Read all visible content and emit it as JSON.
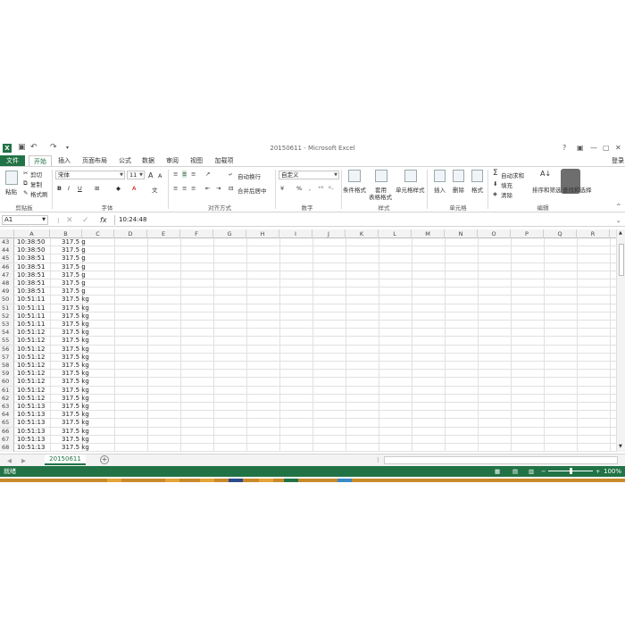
{
  "app": {
    "window_title": "20150611 - Microsoft Excel",
    "logo_letter": "X",
    "help": "?",
    "sign_in": "登录"
  },
  "tabs": [
    "文件",
    "开始",
    "插入",
    "页面布局",
    "公式",
    "数据",
    "审阅",
    "视图",
    "加载项"
  ],
  "ribbon": {
    "clipboard": {
      "paste": "粘贴",
      "cut": "剪切",
      "copy": "复制",
      "format_painter": "格式刷",
      "group": "剪贴板"
    },
    "font": {
      "name": "宋体",
      "size": "11",
      "bold": "B",
      "italic": "I",
      "underline": "U",
      "grow": "A",
      "shrink": "A",
      "group": "字体"
    },
    "alignment": {
      "wrap": "自动换行",
      "merge": "合并后居中",
      "group": "对齐方式"
    },
    "number": {
      "format": "自定义",
      "percent": "%",
      "comma": ",",
      "group": "数字"
    },
    "styles": {
      "conditional": "条件格式",
      "table1": "套用",
      "table2": "表格格式",
      "cell_styles": "单元格样式",
      "group": "样式"
    },
    "cells": {
      "insert": "插入",
      "delete": "删除",
      "format": "格式",
      "group": "单元格"
    },
    "editing": {
      "autosum": "自动求和",
      "fill": "填充",
      "clear": "清除",
      "sort": "排序和筛选",
      "find": "查找和选择",
      "group": "编辑"
    }
  },
  "formula_bar": {
    "name_box": "A1",
    "fx": "fx",
    "value": "10:24:48"
  },
  "columns": [
    "A",
    "B",
    "C",
    "D",
    "E",
    "F",
    "G",
    "H",
    "I",
    "J",
    "K",
    "L",
    "M",
    "N",
    "O",
    "P",
    "Q",
    "R"
  ],
  "rows": [
    {
      "n": "43",
      "a": "10:38:50",
      "b": "317.5 g"
    },
    {
      "n": "44",
      "a": "10:38:50",
      "b": "317.5 g"
    },
    {
      "n": "45",
      "a": "10:38:51",
      "b": "317.5 g"
    },
    {
      "n": "46",
      "a": "10:38:51",
      "b": "317.5 g"
    },
    {
      "n": "47",
      "a": "10:38:51",
      "b": "317.5 g"
    },
    {
      "n": "48",
      "a": "10:38:51",
      "b": "317.5 g"
    },
    {
      "n": "49",
      "a": "10:38:51",
      "b": "317.5 g"
    },
    {
      "n": "50",
      "a": "10:51:11",
      "b": "317.5 kg"
    },
    {
      "n": "51",
      "a": "10:51:11",
      "b": "317.5 kg"
    },
    {
      "n": "52",
      "a": "10:51:11",
      "b": "317.5 kg"
    },
    {
      "n": "53",
      "a": "10:51:11",
      "b": "317.5 kg"
    },
    {
      "n": "54",
      "a": "10:51:12",
      "b": "317.5 kg"
    },
    {
      "n": "55",
      "a": "10:51:12",
      "b": "317.5 kg"
    },
    {
      "n": "56",
      "a": "10:51:12",
      "b": "317.5 kg"
    },
    {
      "n": "57",
      "a": "10:51:12",
      "b": "317.5 kg"
    },
    {
      "n": "58",
      "a": "10:51:12",
      "b": "317.5 kg"
    },
    {
      "n": "59",
      "a": "10:51:12",
      "b": "317.5 kg"
    },
    {
      "n": "60",
      "a": "10:51:12",
      "b": "317.5 kg"
    },
    {
      "n": "61",
      "a": "10:51:12",
      "b": "317.5 kg"
    },
    {
      "n": "62",
      "a": "10:51:12",
      "b": "317.5 kg"
    },
    {
      "n": "63",
      "a": "10:51:13",
      "b": "317.5 kg"
    },
    {
      "n": "64",
      "a": "10:51:13",
      "b": "317.5 kg"
    },
    {
      "n": "65",
      "a": "10:51:13",
      "b": "317.5 kg"
    },
    {
      "n": "66",
      "a": "10:51:13",
      "b": "317.5 kg"
    },
    {
      "n": "67",
      "a": "10:51:13",
      "b": "317.5 kg"
    },
    {
      "n": "68",
      "a": "10:51:13",
      "b": "317.5 kg"
    }
  ],
  "sheet": {
    "name": "20150611",
    "add": "+"
  },
  "status": {
    "ready": "就绪",
    "zoom": "100%"
  },
  "colors": {
    "accent": "#217346",
    "taskbar": "#c88a2a"
  }
}
